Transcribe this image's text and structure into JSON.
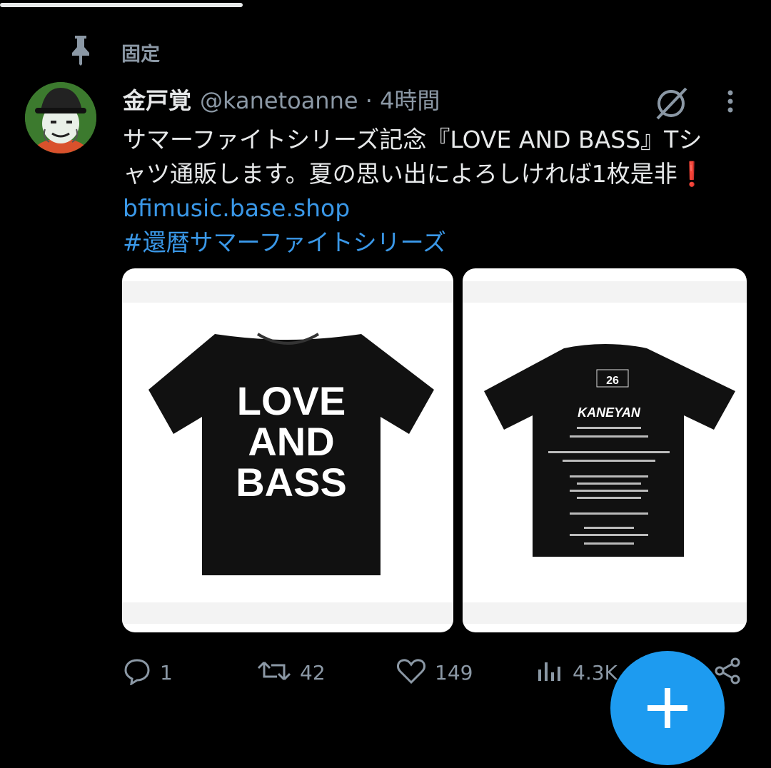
{
  "pinned": {
    "label": "固定"
  },
  "tweet": {
    "author_name": "金戸覚",
    "handle_line": "@kanetoanne · 4時間",
    "text_line1": "サマーファイトシリーズ記念『LOVE AND BASS』Tシ",
    "text_line2": "ャツ通販します。夏の思い出によろしければ1枚是非❗️",
    "link": "bfimusic.base.shop",
    "hashtag": "#還暦サマーファイトシリーズ"
  },
  "images": {
    "front": {
      "shirt_text": [
        "LOVE",
        "AND",
        "BASS"
      ]
    },
    "back": {
      "series_badge": "26",
      "headliner": "KANEYAN"
    }
  },
  "actions": {
    "replies": "1",
    "reposts": "42",
    "likes": "149",
    "views": "4.3K"
  },
  "colors": {
    "accent": "#1d9bf0",
    "link": "#3a98e8",
    "muted": "#8b98a5",
    "background": "#000000"
  }
}
